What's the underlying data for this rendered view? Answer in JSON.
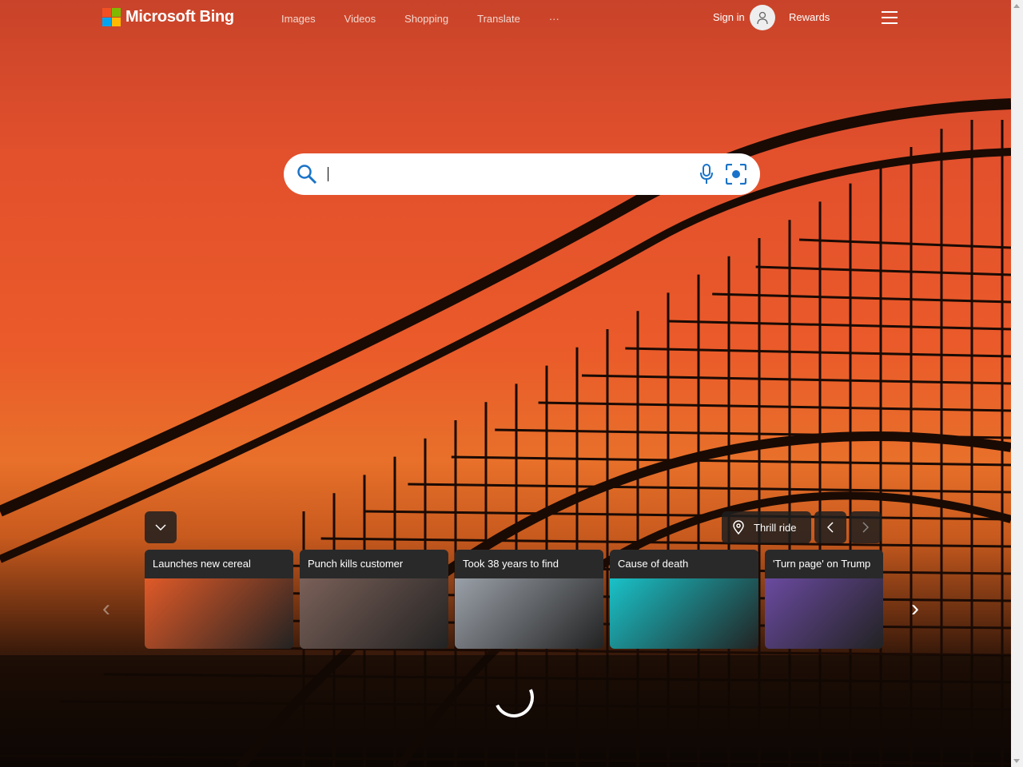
{
  "header": {
    "logo_text": "Microsoft Bing",
    "nav": [
      "Images",
      "Videos",
      "Shopping",
      "Translate",
      "···"
    ],
    "sign_in": "Sign in",
    "rewards": "Rewards"
  },
  "search": {
    "value": ""
  },
  "location": {
    "label": "Thrill ride"
  },
  "news": [
    {
      "title": "Launches new cereal",
      "color": "#e05a28"
    },
    {
      "title": "Punch kills customer",
      "color": "#7a6058"
    },
    {
      "title": "Took 38 years to find",
      "color": "#9aa0a8"
    },
    {
      "title": "Cause of death",
      "color": "#19c2c8"
    },
    {
      "title": "'Turn page' on Trump",
      "color": "#6a4aa0"
    }
  ]
}
